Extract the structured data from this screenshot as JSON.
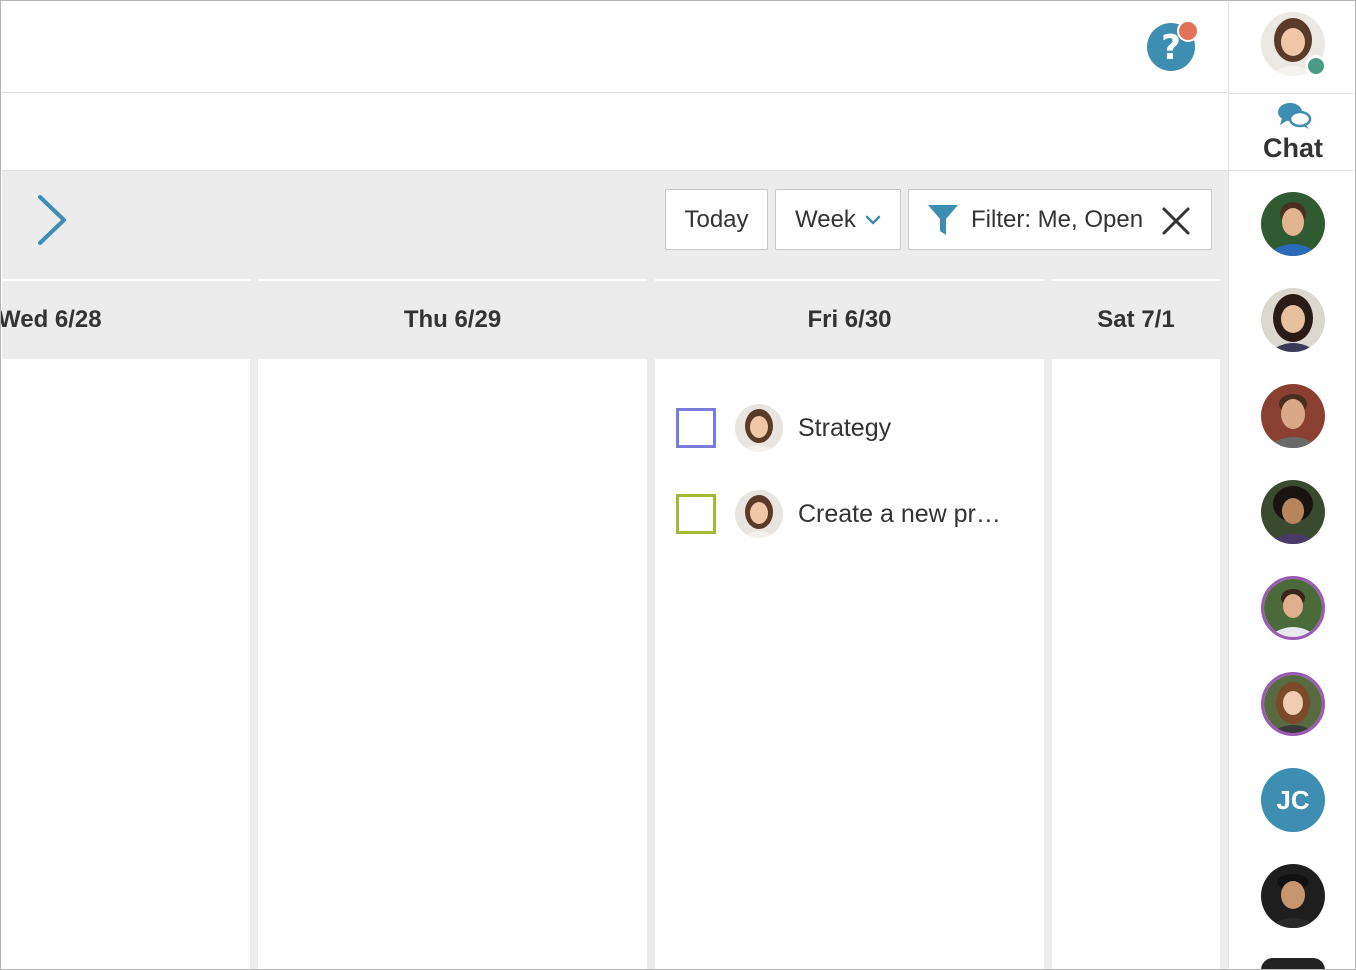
{
  "toolbar": {
    "today_label": "Today",
    "view_label": "Week",
    "filter_label": "Filter: Me, Open"
  },
  "days": [
    {
      "label": "Wed 6/28"
    },
    {
      "label": "Thu 6/29"
    },
    {
      "label": "Fri 6/30"
    },
    {
      "label": "Sat 7/1"
    }
  ],
  "tasks": [
    {
      "label": "Strategy",
      "checkbox_color": "#7b7bde"
    },
    {
      "label": "Create a new pr…",
      "checkbox_color": "#a3b837"
    }
  ],
  "sidebar": {
    "chat_label": "Chat",
    "member_initials": "JC"
  },
  "colors": {
    "accent": "#3d8eb0",
    "help_badge": "#e0735a",
    "online": "#4a9a86",
    "ring": "#9b59b6"
  }
}
